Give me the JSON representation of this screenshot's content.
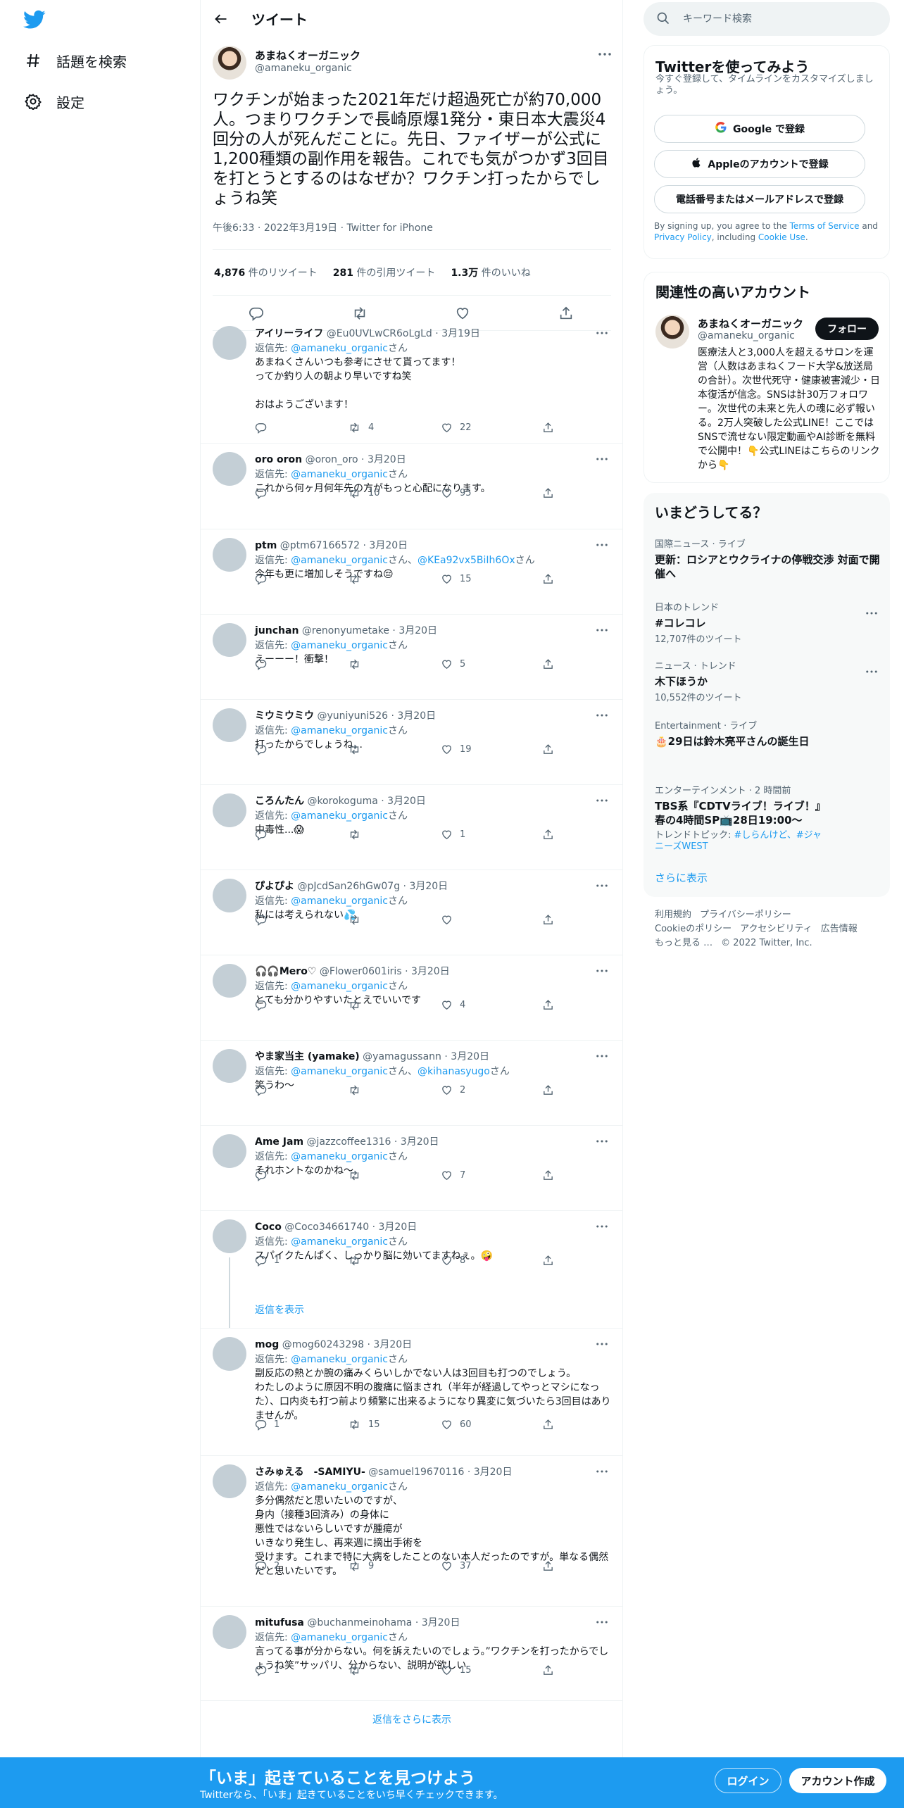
{
  "nav": {
    "explore_label": "話題を検索",
    "settings_label": "設定"
  },
  "header": {
    "title": "ツイート"
  },
  "main_tweet": {
    "name": "あまねくオーガニック",
    "handle": "@amaneku_organic",
    "text": "ワクチンが始まった2021年だけ超過死亡が約70,000人。つまりワクチンで長崎原爆1発分・東日本大震災4回分の人が死んだことに。先日、ファイザーが公式に1,200種類の副作用を報告。これでも気がつかず3回目を打とうとするのはなぜか？ワクチン打ったからでしょうね笑",
    "time": "午後6:33",
    "date": "2022年3月19日",
    "source": "Twitter for iPhone",
    "retweets": "4,876",
    "retweets_label": "件のリツイート",
    "quotes": "281",
    "quotes_label": "件の引用ツイート",
    "likes": "1.3万",
    "likes_label": "件のいいね"
  },
  "reply_prefix": "返信先: ",
  "reply_suffix": "さん",
  "replies": [
    {
      "name": "アイリーライフ",
      "handle": "@Eu0UVLwCR6oLgLd",
      "date": "3月19日",
      "to": [
        "@amaneku_organic"
      ],
      "text": "あまねくさんいつも参考にさせて貰ってます！\nってか釣り人の朝より早いですね笑\n\nおはようございます！",
      "replies": "",
      "retweets": "4",
      "likes": "22"
    },
    {
      "name": "oro oron",
      "handle": "@oron_oro",
      "date": "3月20日",
      "to": [
        "@amaneku_organic"
      ],
      "text": "これから何ヶ月何年先の方がもっと心配になります。",
      "replies": "",
      "retweets": "10",
      "likes": "95"
    },
    {
      "name": "ptm",
      "handle": "@ptm67166572",
      "date": "3月20日",
      "to": [
        "@amaneku_organic",
        "@KEa92vx5BiIh6Ox"
      ],
      "text": "今年も更に増加しそうですね😔",
      "replies": "",
      "retweets": "",
      "likes": "15"
    },
    {
      "name": "junchan",
      "handle": "@renonyumetake",
      "date": "3月20日",
      "to": [
        "@amaneku_organic"
      ],
      "text": "えーーー！衝撃！",
      "replies": "",
      "retweets": "",
      "likes": "5"
    },
    {
      "name": "ミウミウミウ",
      "handle": "@yuniyuni526",
      "date": "3月20日",
      "to": [
        "@amaneku_organic"
      ],
      "text": "打ったからでしょうね...",
      "replies": "",
      "retweets": "",
      "likes": "19"
    },
    {
      "name": "ころんたん",
      "handle": "@korokoguma",
      "date": "3月20日",
      "to": [
        "@amaneku_organic"
      ],
      "text": "中毒性...😱",
      "replies": "",
      "retweets": "",
      "likes": "1"
    },
    {
      "name": "ぴよぴよ",
      "handle": "@pJcdSan26hGw07g",
      "date": "3月20日",
      "to": [
        "@amaneku_organic"
      ],
      "text": "私には考えられない💦",
      "replies": "",
      "retweets": "",
      "likes": ""
    },
    {
      "name": "🎧🎧Mero♡",
      "handle": "@Flower0601iris",
      "date": "3月20日",
      "to": [
        "@amaneku_organic"
      ],
      "text": "とても分かりやすいたとえでいいです",
      "replies": "",
      "retweets": "",
      "likes": "4"
    },
    {
      "name": "やま家当主 (yamake)",
      "handle": "@yamagussann",
      "date": "3月20日",
      "to": [
        "@amaneku_organic",
        "@kihanasyugo"
      ],
      "text": "笑うわ〜",
      "replies": "",
      "retweets": "",
      "likes": "2"
    },
    {
      "name": "Ame Jam",
      "handle": "@jazzcoffee1316",
      "date": "3月20日",
      "to": [
        "@amaneku_organic"
      ],
      "text": "それホントなのかね〜",
      "replies": "",
      "retweets": "",
      "likes": "7"
    },
    {
      "name": "Coco",
      "handle": "@Coco34661740",
      "date": "3月20日",
      "to": [
        "@amaneku_organic"
      ],
      "text": "スパイクたんぱく、しっかり脳に効いてますねぇ。🤪",
      "replies": "1",
      "retweets": "",
      "likes": "8",
      "show_replies": "返信を表示"
    },
    {
      "name": "mog",
      "handle": "@mog60243298",
      "date": "3月20日",
      "to": [
        "@amaneku_organic"
      ],
      "text": "副反応の熱とか腕の痛みくらいしかでない人は3回目も打つのでしょう。\nわたしのように原因不明の腹痛に悩まされ（半年が経過してやっとマシになった）、口内炎も打つ前より頻繁に出来るようになり異変に気づいたら3回目はありませんが。",
      "replies": "1",
      "retweets": "15",
      "likes": "60"
    },
    {
      "name": "さみゅえる　-SAMIYU-",
      "handle": "@samuel19670116",
      "date": "3月20日",
      "to": [
        "@amaneku_organic"
      ],
      "text": "多分偶然だと思いたいのですが、\n身内（接種3回済み）の身体に\n悪性ではないらしいですが腫瘍が\nいきなり発生し、再来週に摘出手術を\n受けます。これまで特に大病をしたことのない本人だったのですが。単なる偶然だと思いたいです。",
      "replies": "2",
      "retweets": "9",
      "likes": "37"
    },
    {
      "name": "mitufusa",
      "handle": "@buchanmeinohama",
      "date": "3月20日",
      "to": [
        "@amaneku_organic"
      ],
      "text": "言ってる事が分からない。何を訴えたいのでしょう。”ワクチンを打ったからでしょうね笑”サッパリ、分からない、説明が欲しい",
      "replies": "1",
      "retweets": "",
      "likes": "15"
    }
  ],
  "more_replies": "返信をさらに表示",
  "search": {
    "placeholder": "キーワード検索"
  },
  "signup_card": {
    "title": "Twitterを使ってみよう",
    "subtitle": "今すぐ登録して、タイムラインをカスタマイズしましょう。",
    "google": "Google で登録",
    "apple": "Appleのアカウントで登録",
    "phone": "電話番号またはメールアドレスで登録",
    "terms_pre": "By signing up, you agree to the ",
    "terms_link": "Terms of Service",
    "terms_and": " and ",
    "privacy_link": "Privacy Policy",
    "terms_including": ", including ",
    "cookie_link": "Cookie Use",
    "terms_end": "."
  },
  "related_card": {
    "title": "関連性の高いアカウント",
    "name": "あまねくオーガニック",
    "handle": "@amaneku_organic",
    "follow": "フォロー",
    "bio": "医療法人と3,000人を超えるサロンを運営（人数はあまねくフード大学&放送局の合計）。次世代死守・健康被害減少・日本復活が信念。SNSは計30万フォロワー。次世代の未来と先人の魂に必ず報いる。2万人突破した公式LINE！ここではSNSで流せない限定動画やAI診断を無料で公開中！👇公式LINEはこちらのリンクから👇"
  },
  "trends_card": {
    "title": "いまどうしてる？",
    "items": [
      {
        "category": "国際ニュース · ライブ",
        "title": "更新：ロシアとウクライナの停戦交渉 対面で開催へ"
      },
      {
        "category": "日本のトレンド",
        "title": "#コレコレ",
        "count": "12,707件のツイート"
      },
      {
        "category": "ニュース · トレンド",
        "title": "木下ほうか",
        "count": "10,552件のツイート"
      },
      {
        "category": "Entertainment · ライブ",
        "title": "🎂29日は鈴木亮平さんの誕生日"
      },
      {
        "category": "エンターテインメント · 2 時間前",
        "title": "TBS系『CDTVライブ！ライブ！』春の4時間SP📺28日19:00〜",
        "topic_label": "トレンドトピック: ",
        "topics": "#しらんけど、#ジャニーズWEST"
      }
    ],
    "see_more": "さらに表示"
  },
  "footer": {
    "links": [
      "利用規約",
      "プライバシーポリシー",
      "Cookieのポリシー",
      "アクセシビリティ",
      "広告情報",
      "もっと見る …"
    ],
    "copyright": "© 2022 Twitter, Inc."
  },
  "bottom_bar": {
    "title": "「いま」起きていることを見つけよう",
    "subtitle": "Twitterなら、「いま」起きていることをいち早くチェックできます。",
    "login": "ログイン",
    "signup": "アカウント作成"
  },
  "colors": {
    "accent": "#1d9bf0",
    "text": "#0f1419",
    "muted": "#536471",
    "border": "#eff3f4"
  }
}
